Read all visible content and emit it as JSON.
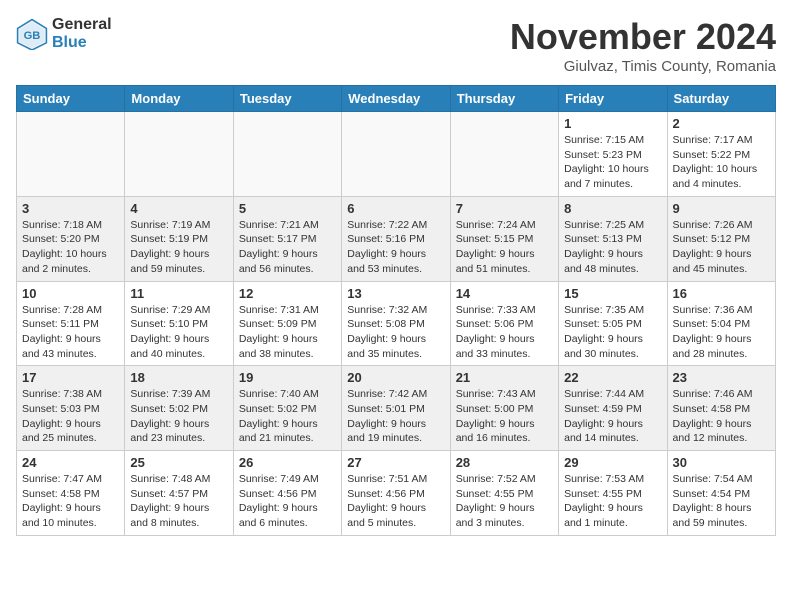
{
  "logo": {
    "general": "General",
    "blue": "Blue"
  },
  "title": "November 2024",
  "location": "Giulvaz, Timis County, Romania",
  "weekdays": [
    "Sunday",
    "Monday",
    "Tuesday",
    "Wednesday",
    "Thursday",
    "Friday",
    "Saturday"
  ],
  "weeks": [
    [
      {
        "day": "",
        "info": "",
        "empty": true
      },
      {
        "day": "",
        "info": "",
        "empty": true
      },
      {
        "day": "",
        "info": "",
        "empty": true
      },
      {
        "day": "",
        "info": "",
        "empty": true
      },
      {
        "day": "",
        "info": "",
        "empty": true
      },
      {
        "day": "1",
        "info": "Sunrise: 7:15 AM\nSunset: 5:23 PM\nDaylight: 10 hours and 7 minutes."
      },
      {
        "day": "2",
        "info": "Sunrise: 7:17 AM\nSunset: 5:22 PM\nDaylight: 10 hours and 4 minutes."
      }
    ],
    [
      {
        "day": "3",
        "info": "Sunrise: 7:18 AM\nSunset: 5:20 PM\nDaylight: 10 hours and 2 minutes."
      },
      {
        "day": "4",
        "info": "Sunrise: 7:19 AM\nSunset: 5:19 PM\nDaylight: 9 hours and 59 minutes."
      },
      {
        "day": "5",
        "info": "Sunrise: 7:21 AM\nSunset: 5:17 PM\nDaylight: 9 hours and 56 minutes."
      },
      {
        "day": "6",
        "info": "Sunrise: 7:22 AM\nSunset: 5:16 PM\nDaylight: 9 hours and 53 minutes."
      },
      {
        "day": "7",
        "info": "Sunrise: 7:24 AM\nSunset: 5:15 PM\nDaylight: 9 hours and 51 minutes."
      },
      {
        "day": "8",
        "info": "Sunrise: 7:25 AM\nSunset: 5:13 PM\nDaylight: 9 hours and 48 minutes."
      },
      {
        "day": "9",
        "info": "Sunrise: 7:26 AM\nSunset: 5:12 PM\nDaylight: 9 hours and 45 minutes."
      }
    ],
    [
      {
        "day": "10",
        "info": "Sunrise: 7:28 AM\nSunset: 5:11 PM\nDaylight: 9 hours and 43 minutes."
      },
      {
        "day": "11",
        "info": "Sunrise: 7:29 AM\nSunset: 5:10 PM\nDaylight: 9 hours and 40 minutes."
      },
      {
        "day": "12",
        "info": "Sunrise: 7:31 AM\nSunset: 5:09 PM\nDaylight: 9 hours and 38 minutes."
      },
      {
        "day": "13",
        "info": "Sunrise: 7:32 AM\nSunset: 5:08 PM\nDaylight: 9 hours and 35 minutes."
      },
      {
        "day": "14",
        "info": "Sunrise: 7:33 AM\nSunset: 5:06 PM\nDaylight: 9 hours and 33 minutes."
      },
      {
        "day": "15",
        "info": "Sunrise: 7:35 AM\nSunset: 5:05 PM\nDaylight: 9 hours and 30 minutes."
      },
      {
        "day": "16",
        "info": "Sunrise: 7:36 AM\nSunset: 5:04 PM\nDaylight: 9 hours and 28 minutes."
      }
    ],
    [
      {
        "day": "17",
        "info": "Sunrise: 7:38 AM\nSunset: 5:03 PM\nDaylight: 9 hours and 25 minutes."
      },
      {
        "day": "18",
        "info": "Sunrise: 7:39 AM\nSunset: 5:02 PM\nDaylight: 9 hours and 23 minutes."
      },
      {
        "day": "19",
        "info": "Sunrise: 7:40 AM\nSunset: 5:02 PM\nDaylight: 9 hours and 21 minutes."
      },
      {
        "day": "20",
        "info": "Sunrise: 7:42 AM\nSunset: 5:01 PM\nDaylight: 9 hours and 19 minutes."
      },
      {
        "day": "21",
        "info": "Sunrise: 7:43 AM\nSunset: 5:00 PM\nDaylight: 9 hours and 16 minutes."
      },
      {
        "day": "22",
        "info": "Sunrise: 7:44 AM\nSunset: 4:59 PM\nDaylight: 9 hours and 14 minutes."
      },
      {
        "day": "23",
        "info": "Sunrise: 7:46 AM\nSunset: 4:58 PM\nDaylight: 9 hours and 12 minutes."
      }
    ],
    [
      {
        "day": "24",
        "info": "Sunrise: 7:47 AM\nSunset: 4:58 PM\nDaylight: 9 hours and 10 minutes."
      },
      {
        "day": "25",
        "info": "Sunrise: 7:48 AM\nSunset: 4:57 PM\nDaylight: 9 hours and 8 minutes."
      },
      {
        "day": "26",
        "info": "Sunrise: 7:49 AM\nSunset: 4:56 PM\nDaylight: 9 hours and 6 minutes."
      },
      {
        "day": "27",
        "info": "Sunrise: 7:51 AM\nSunset: 4:56 PM\nDaylight: 9 hours and 5 minutes."
      },
      {
        "day": "28",
        "info": "Sunrise: 7:52 AM\nSunset: 4:55 PM\nDaylight: 9 hours and 3 minutes."
      },
      {
        "day": "29",
        "info": "Sunrise: 7:53 AM\nSunset: 4:55 PM\nDaylight: 9 hours and 1 minute."
      },
      {
        "day": "30",
        "info": "Sunrise: 7:54 AM\nSunset: 4:54 PM\nDaylight: 8 hours and 59 minutes."
      }
    ]
  ]
}
